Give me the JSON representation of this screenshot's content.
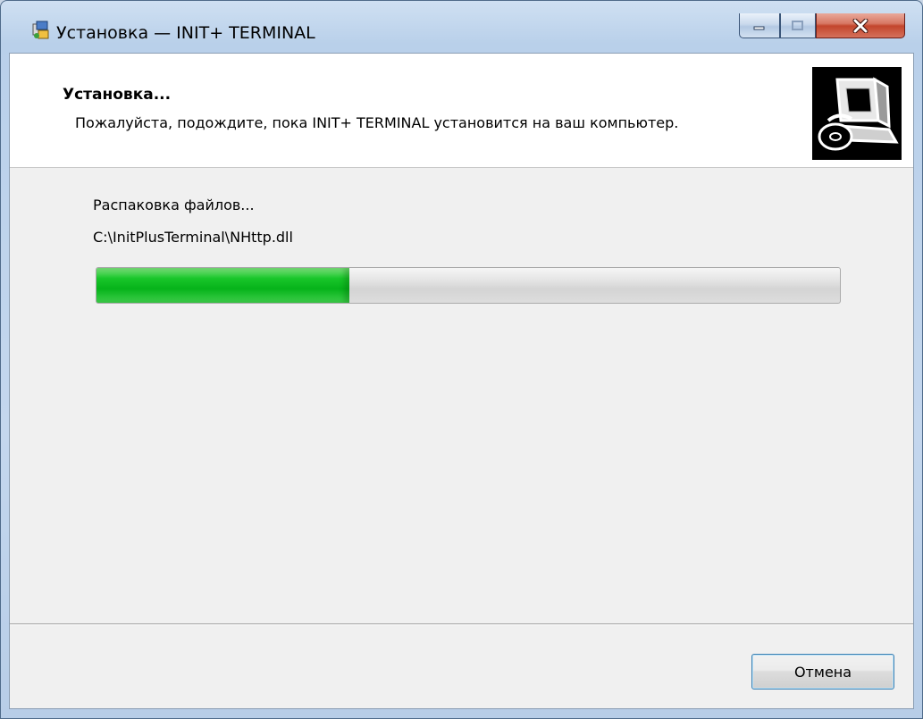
{
  "window": {
    "title": "Установка — INIT+ TERMINAL"
  },
  "header": {
    "title": "Установка...",
    "description": "Пожалуйста, подождите, пока INIT+ TERMINAL установится на ваш компьютер.",
    "logo_icon": "installer-computer-icon"
  },
  "main": {
    "status": "Распаковка файлов...",
    "current_file": "C:\\InitPlusTerminal\\NHttp.dll",
    "progress_fraction": 0.34
  },
  "buttons": {
    "cancel_label": "Отмена"
  },
  "colors": {
    "progress_fill": "#06b31a",
    "header_bg": "#ffffff",
    "client_bg": "#f0f0f0"
  }
}
